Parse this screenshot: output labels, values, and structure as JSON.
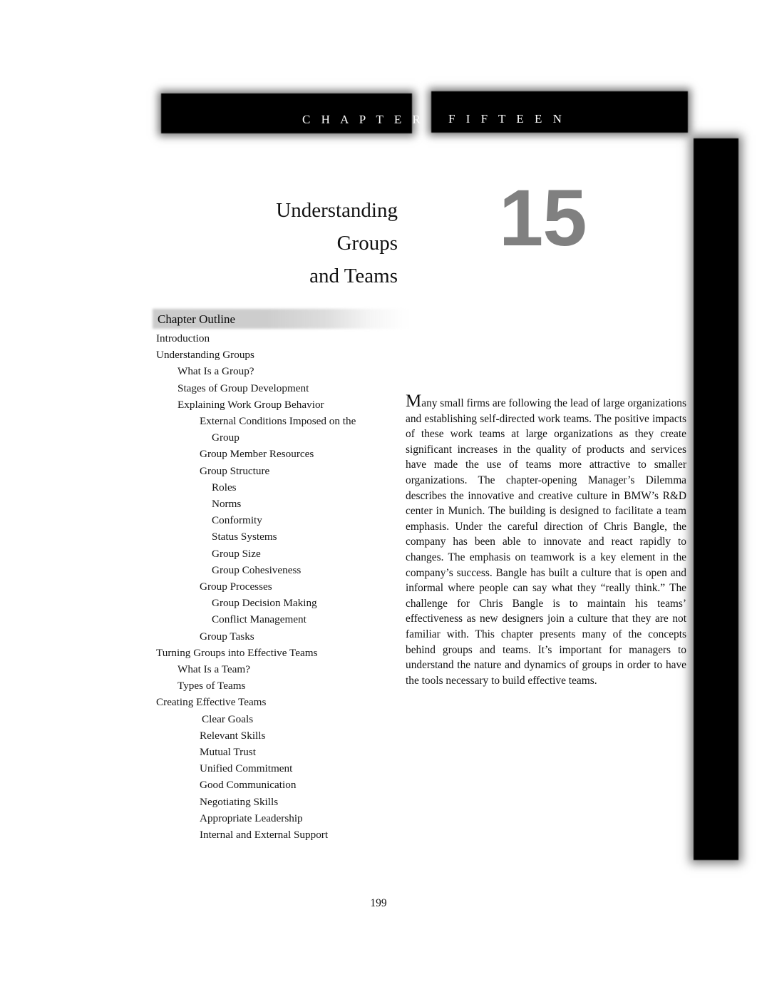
{
  "header": {
    "chapter_word": "C H A P T E R",
    "chapter_ordinal": "F I F T E E N"
  },
  "title": {
    "line1": "Understanding",
    "line2": "Groups",
    "line3": "and Teams",
    "number": "15",
    "number_color": "#808080"
  },
  "outline": {
    "heading": "Chapter Outline",
    "items": [
      {
        "label": "Introduction",
        "level": 0
      },
      {
        "label": "Understanding Groups",
        "level": 0
      },
      {
        "label": "What Is a Group?",
        "level": 1
      },
      {
        "label": "Stages of Group Development",
        "level": 1
      },
      {
        "label": "Explaining Work Group Behavior",
        "level": 1
      },
      {
        "label": "External Conditions Imposed on the",
        "level": 2,
        "continuation": "Group"
      },
      {
        "label": "Group Member Resources",
        "level": 2
      },
      {
        "label": "Group Structure",
        "level": 2
      },
      {
        "label": "Roles",
        "level": 3
      },
      {
        "label": "Norms",
        "level": 3
      },
      {
        "label": "Conformity",
        "level": 3
      },
      {
        "label": "Status Systems",
        "level": 3
      },
      {
        "label": "Group Size",
        "level": 3
      },
      {
        "label": "Group Cohesiveness",
        "level": 3
      },
      {
        "label": "Group Processes",
        "level": 2
      },
      {
        "label": "Group Decision Making",
        "level": 3
      },
      {
        "label": "Conflict Management",
        "level": 3
      },
      {
        "label": "Group Tasks",
        "level": 2
      },
      {
        "label": "Turning Groups into Effective Teams",
        "level": 0
      },
      {
        "label": "What Is a Team?",
        "level": 1
      },
      {
        "label": "Types of Teams",
        "level": 1
      },
      {
        "label": "Creating Effective Teams",
        "level": 0
      },
      {
        "label": "Clear Goals",
        "level": "2b"
      },
      {
        "label": "Relevant Skills",
        "level": 2
      },
      {
        "label": "Mutual Trust",
        "level": 2
      },
      {
        "label": "Unified Commitment",
        "level": 2
      },
      {
        "label": "Good Communication",
        "level": 2
      },
      {
        "label": "Negotiating Skills",
        "level": 2
      },
      {
        "label": "Appropriate Leadership",
        "level": 2
      },
      {
        "label": "Internal and External Support",
        "level": 2
      }
    ]
  },
  "intro": {
    "dropcap": "M",
    "body": "any small firms are following the lead of large organizations and establishing self-directed work teams. The positive impacts of these work teams at large organizations as they create significant increases in the quality of products and services have made the use of teams more attractive to smaller organizations.  The chapter-opening Manager’s Dilemma describes the innovative and creative culture in BMW’s R&D center in Munich.  The building is designed to facilitate a team emphasis.  Under the careful direction of Chris Bangle, the company has been able to innovate and react rapidly to changes.  The emphasis on teamwork is a key element in the company’s success.  Bangle has built a culture that is open and informal where people can say what they “really think.”  The challenge for Chris Bangle is to maintain his teams’ effectiveness as new designers join a culture that they are not familiar with. This chapter presents many of the concepts behind groups and teams. It’s important for managers to understand the nature and dynamics of groups in order to have the tools necessary to build effective teams."
  },
  "footer": {
    "page_number": "199"
  }
}
